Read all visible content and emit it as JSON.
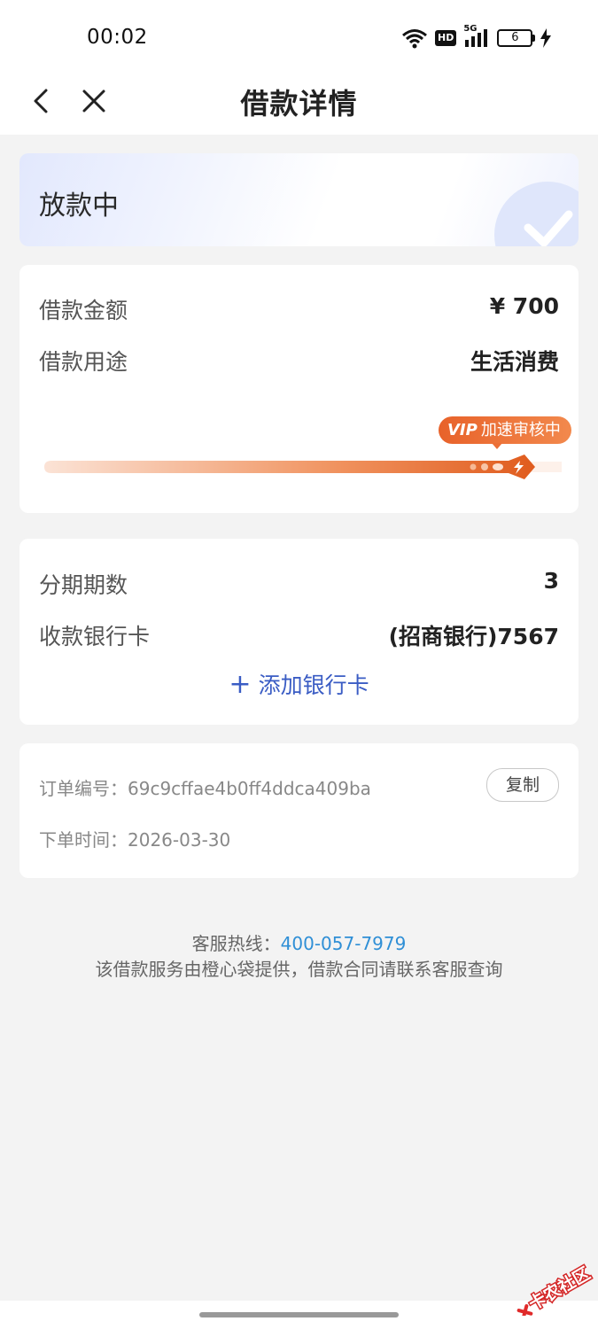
{
  "status_bar": {
    "time": "00:02",
    "network_badge": "HD",
    "signal_label": "5G",
    "battery_level": "6"
  },
  "nav": {
    "title": "借款详情"
  },
  "status_card": {
    "status_text": "放款中"
  },
  "loan_card": {
    "amount_label": "借款金额",
    "amount_value": "¥ 700",
    "purpose_label": "借款用途",
    "purpose_value": "生活消费",
    "vip_badge_prefix": "VIP",
    "vip_badge_text": "加速审核中"
  },
  "bank_card": {
    "installments_label": "分期期数",
    "installments_value": "3",
    "receive_card_label": "收款银行卡",
    "receive_card_value": "(招商银行)7567",
    "add_bank_plus": "+",
    "add_bank_label": "添加银行卡"
  },
  "order_card": {
    "order_no_label": "订单编号：",
    "order_no_value": "69c9cffae4b0ff4ddca409ba",
    "copy_label": "复制",
    "order_time_label": "下单时间：",
    "order_time_value": "2026-03-30"
  },
  "footer": {
    "hotline_label": "客服热线：",
    "hotline_number": "400-057-7979",
    "disclaimer": "该借款服务由橙心袋提供，借款合同请联系客服查询"
  },
  "watermark": {
    "text": "卡农社区"
  },
  "colors": {
    "accent_blue": "#3a5cc4",
    "link_blue": "#2f8fd6",
    "progress_orange": "#e8622a",
    "page_bg": "#f3f3f3"
  }
}
